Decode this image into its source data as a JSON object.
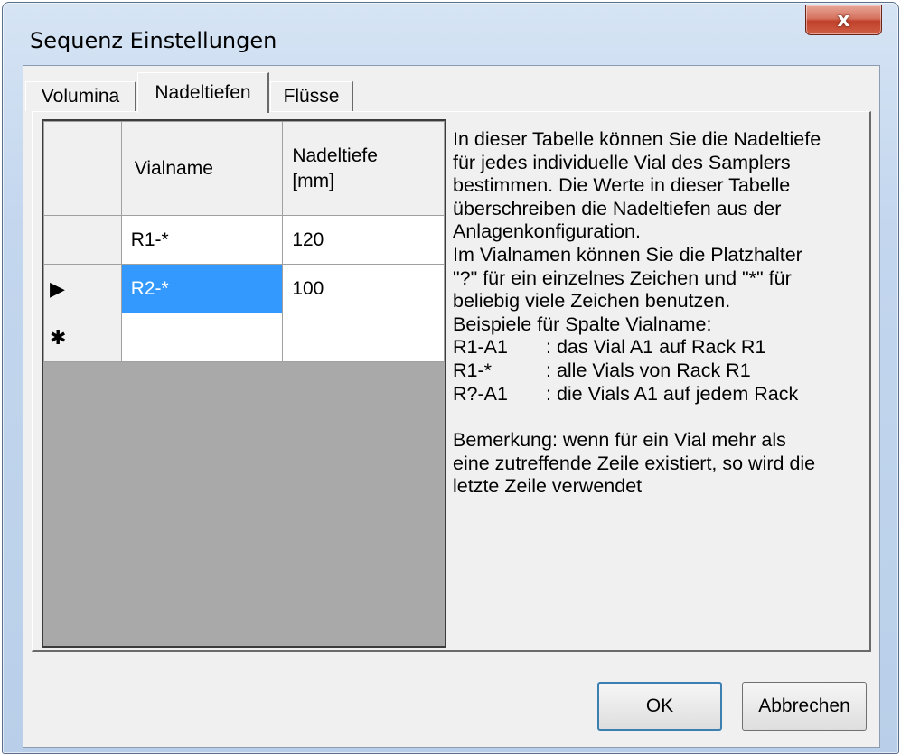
{
  "window": {
    "title": "Sequenz Einstellungen",
    "close_label": "x"
  },
  "tabs": [
    {
      "label": "Volumina",
      "active": false
    },
    {
      "label": "Nadeltiefen",
      "active": true
    },
    {
      "label": "Flüsse",
      "active": false
    }
  ],
  "grid": {
    "columns": [
      "Vialname",
      "Nadeltiefe [mm]"
    ],
    "column_header_lines": [
      [
        "Vialname"
      ],
      [
        "Nadeltiefe",
        "[mm]"
      ]
    ],
    "rows": [
      {
        "indicator": "",
        "vialname": "R1-*",
        "nadeltiefe": "120",
        "selected": false
      },
      {
        "indicator": "▶",
        "vialname": "R2-*",
        "nadeltiefe": "100",
        "selected": true
      },
      {
        "indicator": "✱",
        "vialname": "",
        "nadeltiefe": "",
        "selected": false
      }
    ]
  },
  "description": {
    "lines": [
      "In dieser Tabelle können Sie die Nadeltiefe",
      "für jedes individuelle Vial des Samplers",
      "bestimmen. Die Werte in dieser Tabelle",
      "überschreiben die Nadeltiefen aus der",
      "Anlagenkonfiguration.",
      "Im Vialnamen können Sie die Platzhalter",
      "\"?\" für ein einzelnes Zeichen und \"*\"  für",
      "beliebig viele Zeichen benutzen.",
      "Beispiele für Spalte Vialname:"
    ],
    "examples": [
      {
        "pattern": "R1-A1",
        "meaning": ": das Vial A1 auf Rack R1"
      },
      {
        "pattern": "R1-*",
        "meaning": ": alle Vials von Rack R1"
      },
      {
        "pattern": "R?-A1",
        "meaning": ": die Vials A1 auf jedem Rack"
      }
    ],
    "remark_lines": [
      "Bemerkung: wenn für ein Vial mehr als",
      "eine zutreffende Zeile existiert, so wird die",
      "letzte Zeile verwendet"
    ]
  },
  "buttons": {
    "ok": "OK",
    "cancel": "Abbrechen"
  }
}
